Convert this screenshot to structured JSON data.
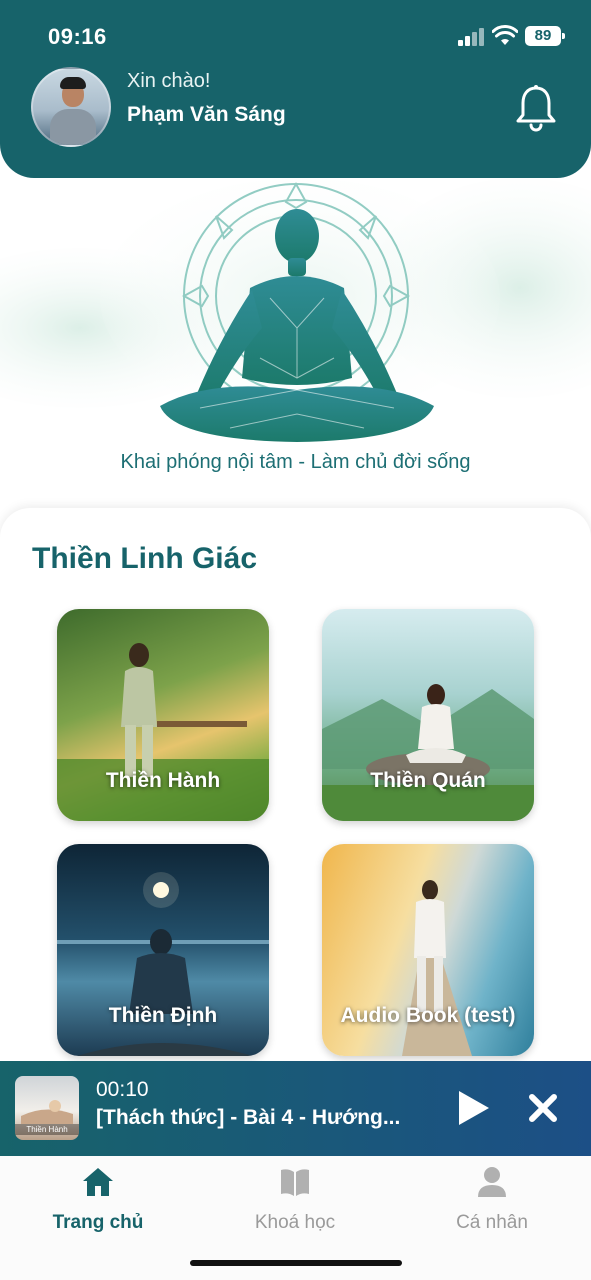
{
  "status_bar": {
    "time": "09:16",
    "battery": "89"
  },
  "header": {
    "greeting": "Xin chào!",
    "username": "Phạm Văn Sáng",
    "notification_icon": "bell-icon"
  },
  "hero": {
    "tagline": "Khai phóng nội tâm - Làm chủ đời sống"
  },
  "section": {
    "title": "Thiền Linh Giác",
    "tiles": [
      {
        "label": "Thiền Hành"
      },
      {
        "label": "Thiền Quán"
      },
      {
        "label": "Thiền Định"
      },
      {
        "label": "Audio Book (test)"
      }
    ]
  },
  "player": {
    "thumb_label": "Thiền Hành",
    "elapsed": "00:10",
    "title": "[Thách thức] - Bài 4 - Hướng...",
    "play_icon": "play-icon",
    "close_icon": "close-icon"
  },
  "nav": {
    "items": [
      {
        "label": "Trang chủ",
        "icon": "home-icon",
        "active": true
      },
      {
        "label": "Khoá học",
        "icon": "book-icon",
        "active": false
      },
      {
        "label": "Cá nhân",
        "icon": "user-icon",
        "active": false
      }
    ]
  },
  "colors": {
    "primary": "#17636a",
    "player_end": "#1c4f86",
    "inactive": "#9a9a9a"
  }
}
